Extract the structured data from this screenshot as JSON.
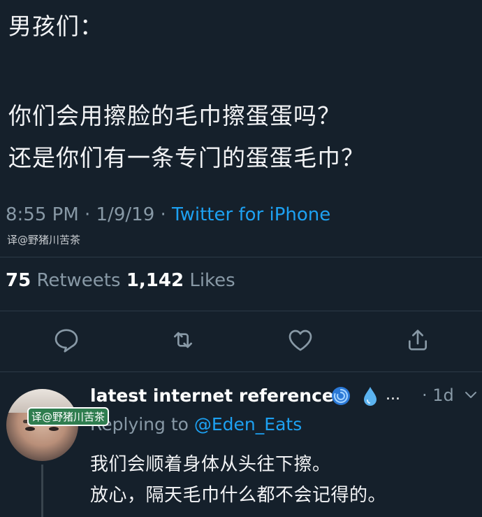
{
  "tweet": {
    "line1": "男孩们：",
    "line2": "你们会用擦脸的毛巾擦蛋蛋吗？",
    "line3": "还是你们有一条专门的蛋蛋毛巾？",
    "timestamp": "8:55 PM · 1/9/19 · ",
    "source": "Twitter for iPhone",
    "watermark": "译@野猪川苦茶",
    "retweets_count": "75",
    "retweets_label": "Retweets",
    "likes_count": "1,142",
    "likes_label": "Likes"
  },
  "actions": [
    {
      "name": "reply-icon"
    },
    {
      "name": "retweet-icon"
    },
    {
      "name": "like-icon"
    },
    {
      "name": "share-icon"
    }
  ],
  "reply": {
    "author": "latest internet reference",
    "emoji_icons": [
      "cyclone-icon",
      "droplet-icon"
    ],
    "ellipsis": "...",
    "time": "· 1d",
    "replying_prefix": "Replying to ",
    "replying_handle": "@Eden_Eats",
    "watermark": "译@野猪川苦茶",
    "body_line1": "我们会顺着身体从头往下擦。",
    "body_line2": "放心，隔天毛巾什么都不会记得的。"
  },
  "colors": {
    "background": "#15202b",
    "accent": "#1da1f2",
    "muted": "#8899a6"
  }
}
